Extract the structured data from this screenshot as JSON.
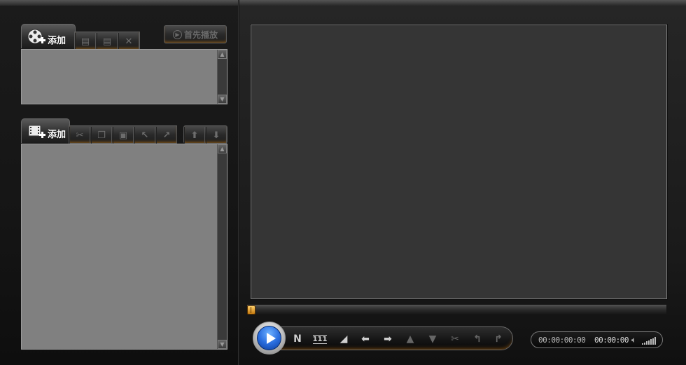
{
  "clip_panel": {
    "add_label": "添加",
    "first_play_label": "首先播放",
    "icons": [
      "film-reel-add-icon",
      "save-icon",
      "save-as-icon",
      "delete-icon"
    ]
  },
  "edit_panel": {
    "add_label": "添加",
    "icons": [
      "film-add-icon",
      "cut-icon",
      "copy-icon",
      "paste-icon",
      "undo-icon",
      "redo-icon",
      "move-up-icon",
      "move-down-icon"
    ]
  },
  "player": {
    "seek_position": 0.0,
    "time_current": "00:00:00:00",
    "time_total": "00:00:00",
    "volume_level": 1.0,
    "controls": [
      {
        "name": "play-button",
        "glyph": "▶"
      },
      {
        "name": "next-frame-button",
        "glyph": "N"
      },
      {
        "name": "frame-counter-button",
        "glyph": "111"
      },
      {
        "name": "mark-in-button",
        "glyph": "◢"
      },
      {
        "name": "step-back-button",
        "glyph": "⬅"
      },
      {
        "name": "step-forward-button",
        "glyph": "➡"
      },
      {
        "name": "up-button",
        "glyph": "▲"
      },
      {
        "name": "down-button",
        "glyph": "▼"
      },
      {
        "name": "cut-button",
        "glyph": "✂"
      },
      {
        "name": "undo-button",
        "glyph": "↰"
      },
      {
        "name": "redo-button",
        "glyph": "↱"
      }
    ]
  },
  "colors": {
    "accent_orange": "#c57a10",
    "play_blue": "#2b6fe0",
    "list_background": "#808080",
    "video_background": "#353535"
  }
}
